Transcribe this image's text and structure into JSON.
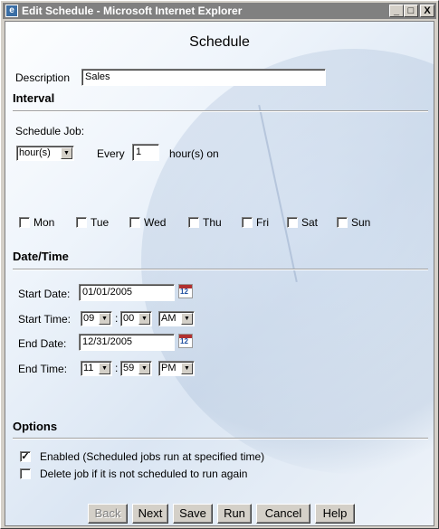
{
  "window": {
    "title": "Edit Schedule - Microsoft Internet Explorer",
    "icon": "ie-icon",
    "minimize": "_",
    "maximize": "□",
    "close": "X"
  },
  "page": {
    "title": "Schedule"
  },
  "description": {
    "label": "Description",
    "value": "Sales"
  },
  "interval": {
    "heading": "Interval",
    "schedule_job_label": "Schedule Job:",
    "unit_selected": "hour(s)",
    "every_label": "Every",
    "every_value": "1",
    "suffix": "hour(s) on",
    "days": [
      {
        "label": "Mon",
        "checked": false
      },
      {
        "label": "Tue",
        "checked": false
      },
      {
        "label": "Wed",
        "checked": false
      },
      {
        "label": "Thu",
        "checked": false
      },
      {
        "label": "Fri",
        "checked": false
      },
      {
        "label": "Sat",
        "checked": false
      },
      {
        "label": "Sun",
        "checked": false
      }
    ]
  },
  "datetime": {
    "heading": "Date/Time",
    "start_date_label": "Start Date:",
    "start_date": "01/01/2005",
    "start_time_label": "Start Time:",
    "start_hour": "09",
    "start_minute": "00",
    "start_ampm": "AM",
    "end_date_label": "End Date:",
    "end_date": "12/31/2005",
    "end_time_label": "End Time:",
    "end_hour": "11",
    "end_minute": "59",
    "end_ampm": "PM",
    "colon": ":",
    "calendar_glyph": "12"
  },
  "options": {
    "heading": "Options",
    "enabled_label": "Enabled (Scheduled jobs run at specified time)",
    "enabled_checked": true,
    "delete_label": "Delete job if it is not scheduled to run again",
    "delete_checked": false
  },
  "buttons": {
    "back": "Back",
    "next": "Next",
    "save": "Save",
    "run": "Run",
    "cancel": "Cancel",
    "help": "Help"
  },
  "glyphs": {
    "check": "✓",
    "down_arrow": "▼"
  }
}
